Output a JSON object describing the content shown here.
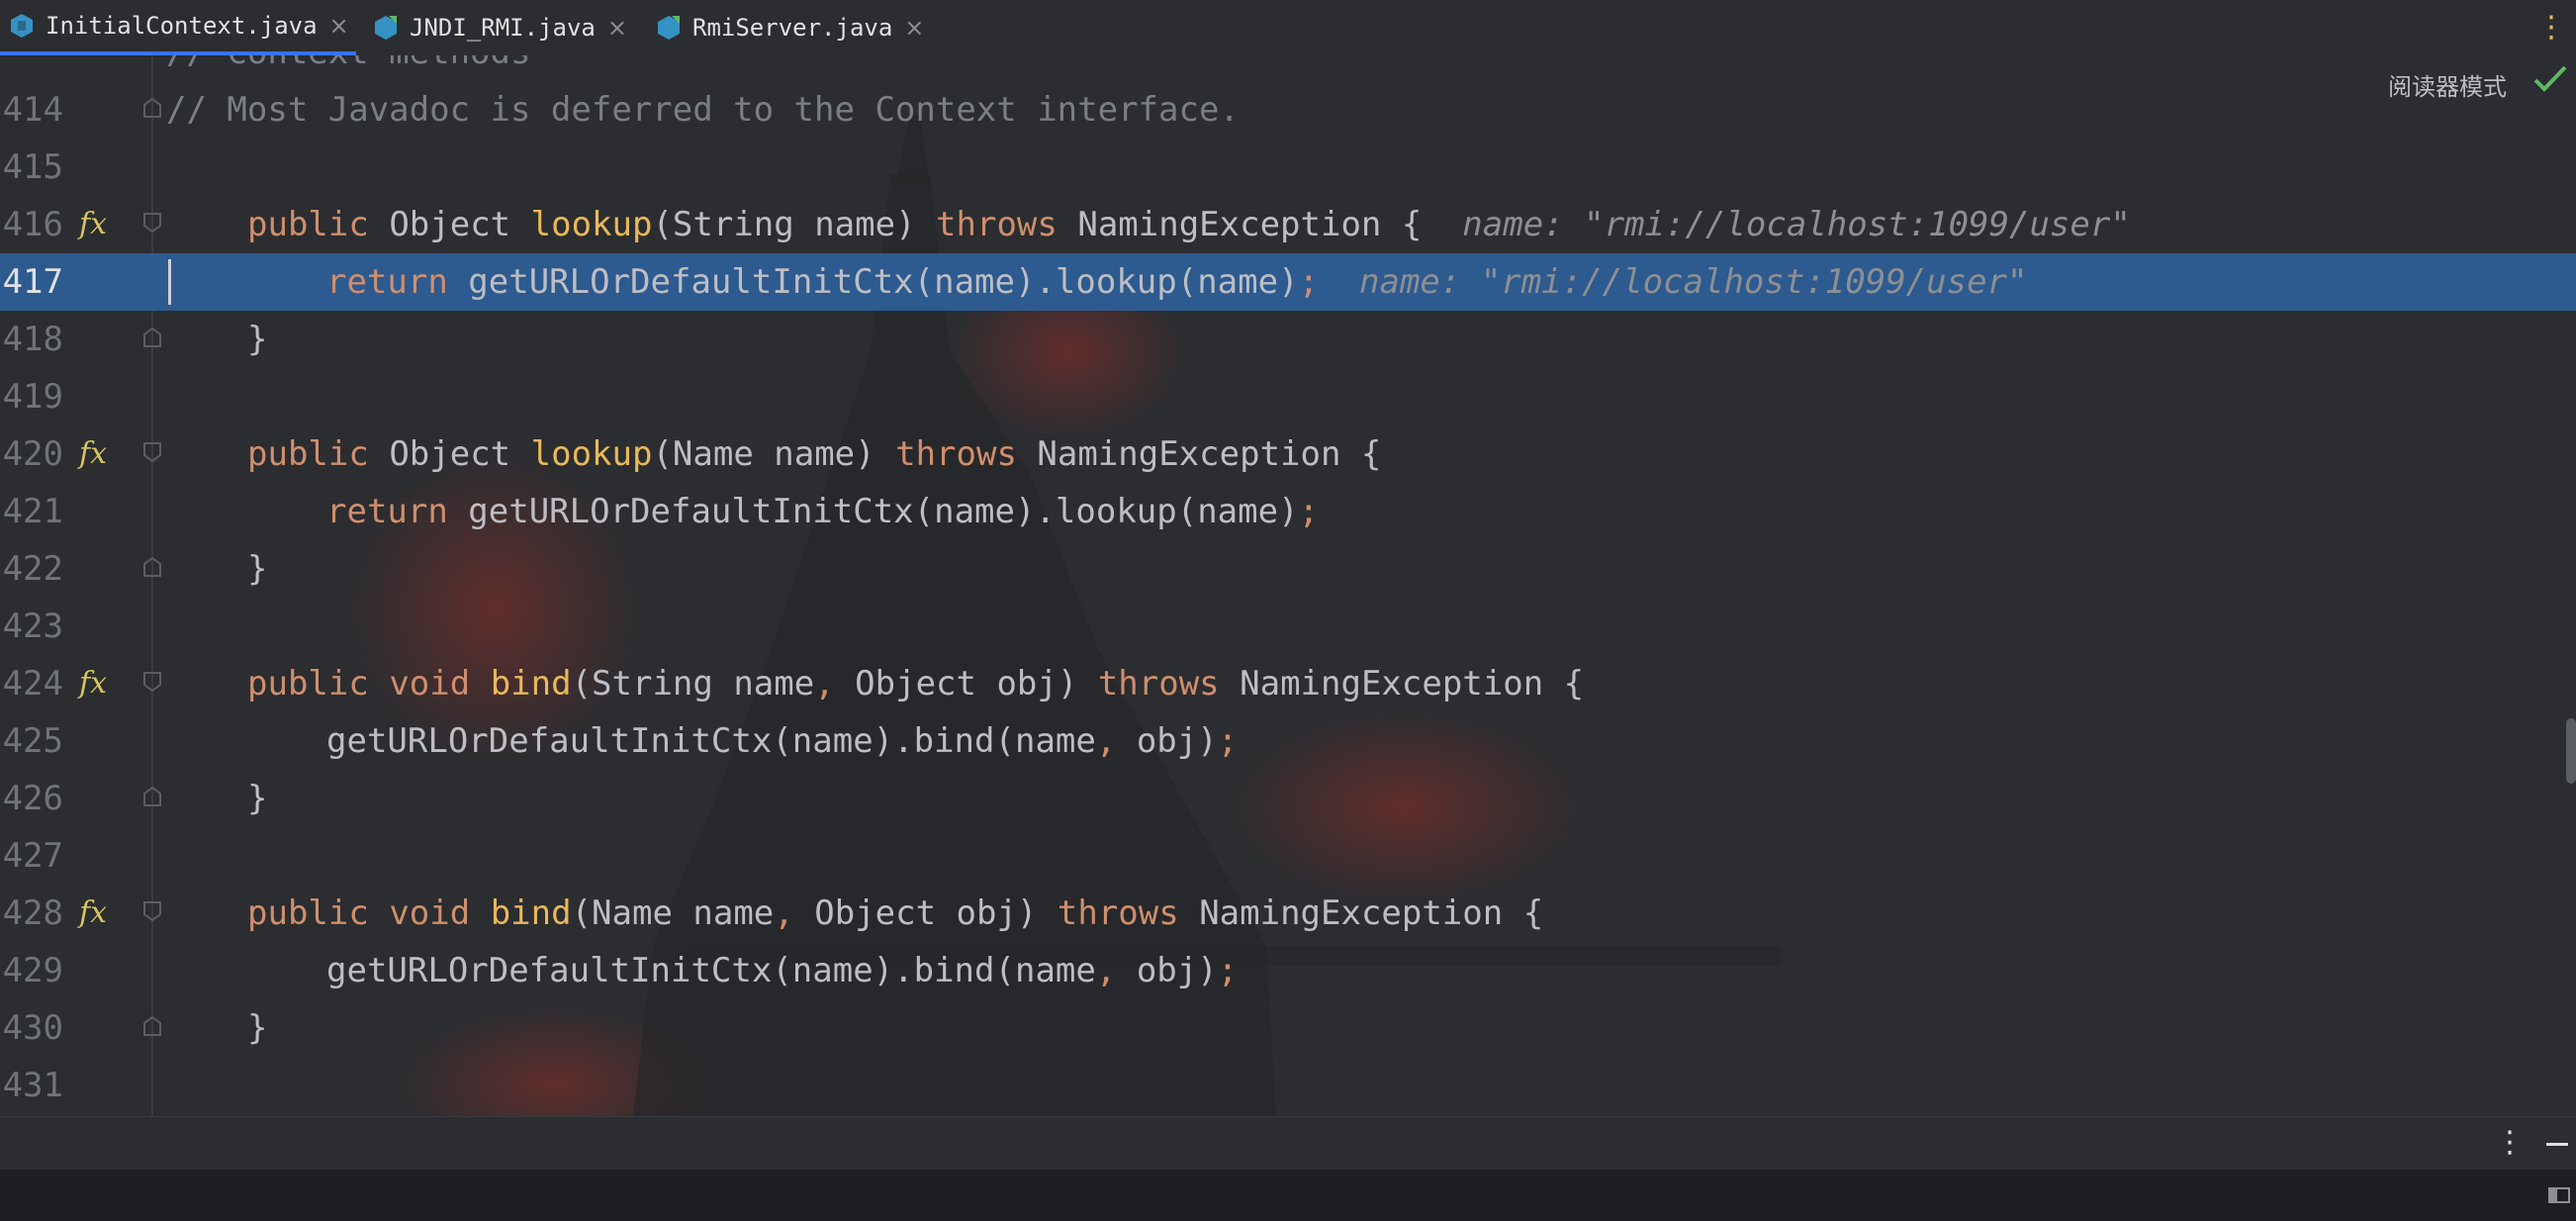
{
  "tabs": [
    {
      "label": "InitialContext.java",
      "active": true
    },
    {
      "label": "JNDI_RMI.java",
      "active": false
    },
    {
      "label": "RmiServer.java",
      "active": false
    }
  ],
  "editor": {
    "reader_mode": "阅读器模式",
    "top_partial": "// Context methods",
    "lines": [
      {
        "n": "414"
      },
      {
        "n": "415"
      },
      {
        "n": "416"
      },
      {
        "n": "417"
      },
      {
        "n": "418"
      },
      {
        "n": "419"
      },
      {
        "n": "420"
      },
      {
        "n": "421"
      },
      {
        "n": "422"
      },
      {
        "n": "423"
      },
      {
        "n": "424"
      },
      {
        "n": "425"
      },
      {
        "n": "426"
      },
      {
        "n": "427"
      },
      {
        "n": "428"
      },
      {
        "n": "429"
      },
      {
        "n": "430"
      },
      {
        "n": "431"
      }
    ],
    "code": {
      "l414": "// Most Javadoc is deferred to the Context interface.",
      "public": "public",
      "object": "Object",
      "void": "void",
      "lookup": "lookup",
      "bind": "bind",
      "throws": "throws",
      "return": "return",
      "naming_exc": "NamingException",
      "brace_open": " {",
      "brace_close": "}",
      "sig_string_name": "(String name) ",
      "sig_name_name": "(Name name) ",
      "sig_string_name_obj_a": "(String name",
      "sig_name_name_obj_a": "(Name name",
      "sig_obj_b": " Object obj) ",
      "comma": ",",
      "semicolon": ";",
      "lookup_call": " getURLOrDefaultInitCtx(name).lookup(name)",
      "bind_call_a": "getURLOrDefaultInitCtx(name).bind(name",
      "bind_call_b": " obj)"
    },
    "hint_416": "name: \"rmi://localhost:1099/user\"",
    "hint_417": "name: \"rmi://localhost:1099/user\"",
    "current_line": "417"
  },
  "colors": {
    "keyword": "#cf8e6d",
    "method_decl": "#e8b85a",
    "current_line_bg": "#2d5a8f",
    "editor_bg": "#2b2d30"
  }
}
